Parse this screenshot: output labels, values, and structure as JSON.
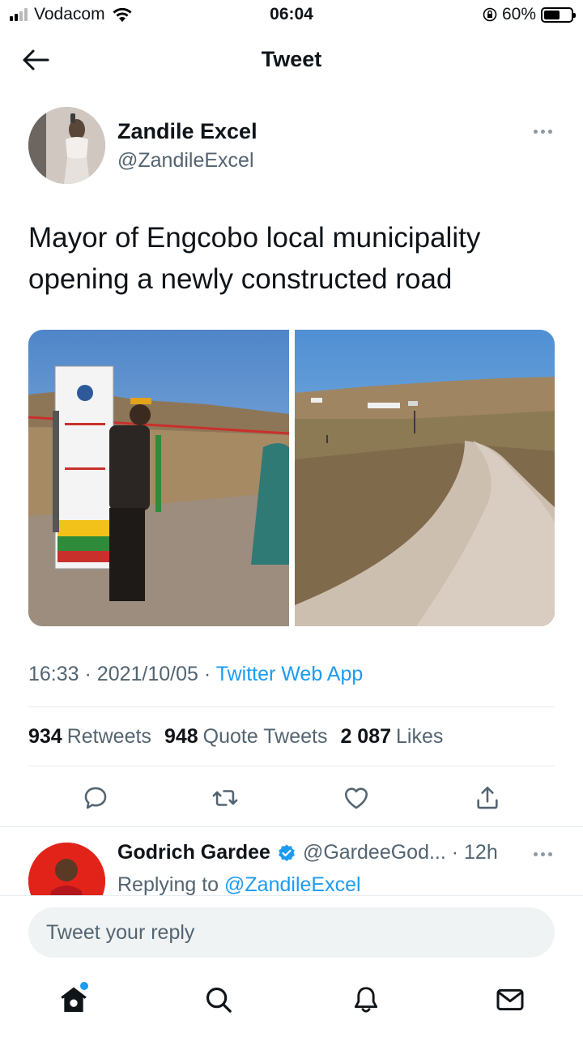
{
  "status_bar": {
    "carrier": "Vodacom",
    "time": "06:04",
    "battery_percent": "60%",
    "battery_level": 0.6
  },
  "header": {
    "title": "Tweet"
  },
  "tweet": {
    "author_name": "Zandile Excel",
    "author_handle": "@ZandileExcel",
    "text": "Mayor of Engcobo local municipality opening a newly constructed road",
    "time": "16:33",
    "date": "2021/10/05",
    "source": "Twitter Web App",
    "stats": {
      "retweets_count": "934",
      "retweets_label": "Retweets",
      "quotes_count": "948",
      "quotes_label": "Quote Tweets",
      "likes_count": "2 087",
      "likes_label": "Likes"
    }
  },
  "reply": {
    "author_name": "Godrich Gardee",
    "author_handle": "@GardeeGod...",
    "age": "12h",
    "replying_prefix": "Replying to",
    "replying_to": "@ZandileExcel"
  },
  "composer": {
    "placeholder": "Tweet your reply"
  },
  "icons": {
    "back": "arrow-left-icon",
    "reply": "comment-icon",
    "retweet": "retweet-icon",
    "like": "heart-icon",
    "share": "share-icon",
    "home": "home-icon",
    "search": "search-icon",
    "notifications": "bell-icon",
    "messages": "mail-icon"
  },
  "colors": {
    "accent": "#1d9bf0",
    "text": "#0f1419",
    "muted": "#536471"
  }
}
